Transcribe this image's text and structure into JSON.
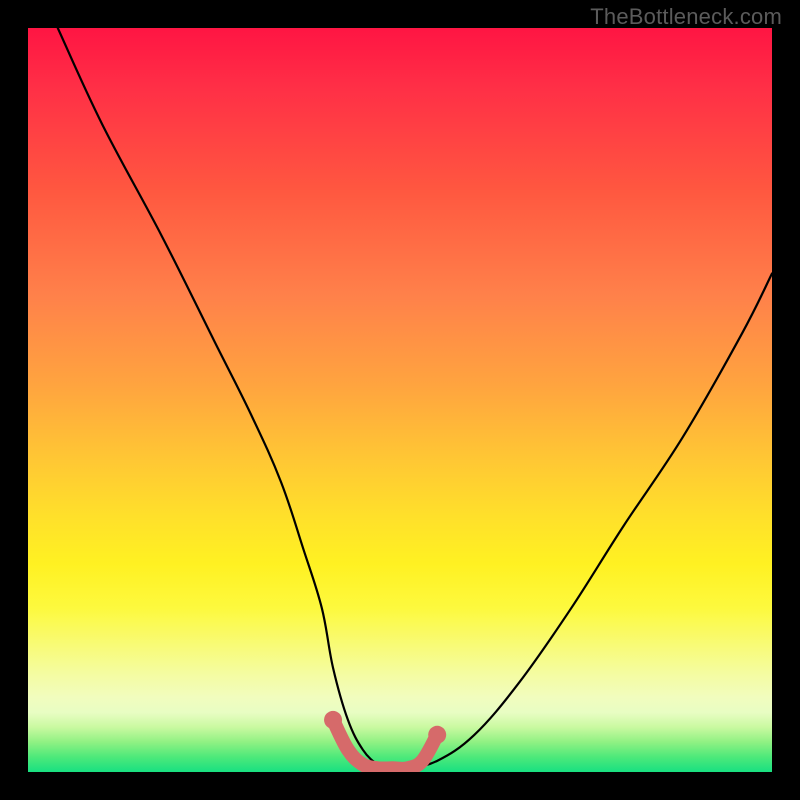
{
  "watermark": "TheBottleneck.com",
  "chart_data": {
    "type": "line",
    "title": "",
    "xlabel": "",
    "ylabel": "",
    "xlim": [
      0,
      100
    ],
    "ylim": [
      0,
      100
    ],
    "series": [
      {
        "name": "bottleneck-curve",
        "x": [
          4,
          10,
          18,
          25,
          30,
          34,
          37,
          39.5,
          41,
          43,
          45,
          47,
          48.5,
          51,
          55,
          60,
          66,
          73,
          80,
          88,
          96,
          100
        ],
        "values": [
          100,
          87,
          72,
          58,
          48,
          39,
          30,
          22,
          14,
          7,
          3,
          1,
          0.5,
          0.5,
          1.5,
          5,
          12,
          22,
          33,
          45,
          59,
          67
        ]
      },
      {
        "name": "optimal-zone",
        "x": [
          41,
          43,
          45,
          47,
          49,
          51,
          53,
          55
        ],
        "values": [
          7,
          3,
          1,
          0.5,
          0.5,
          0.5,
          1.5,
          5
        ]
      }
    ],
    "colors": {
      "curve": "#000000",
      "optimal": "#d66a6a"
    }
  }
}
